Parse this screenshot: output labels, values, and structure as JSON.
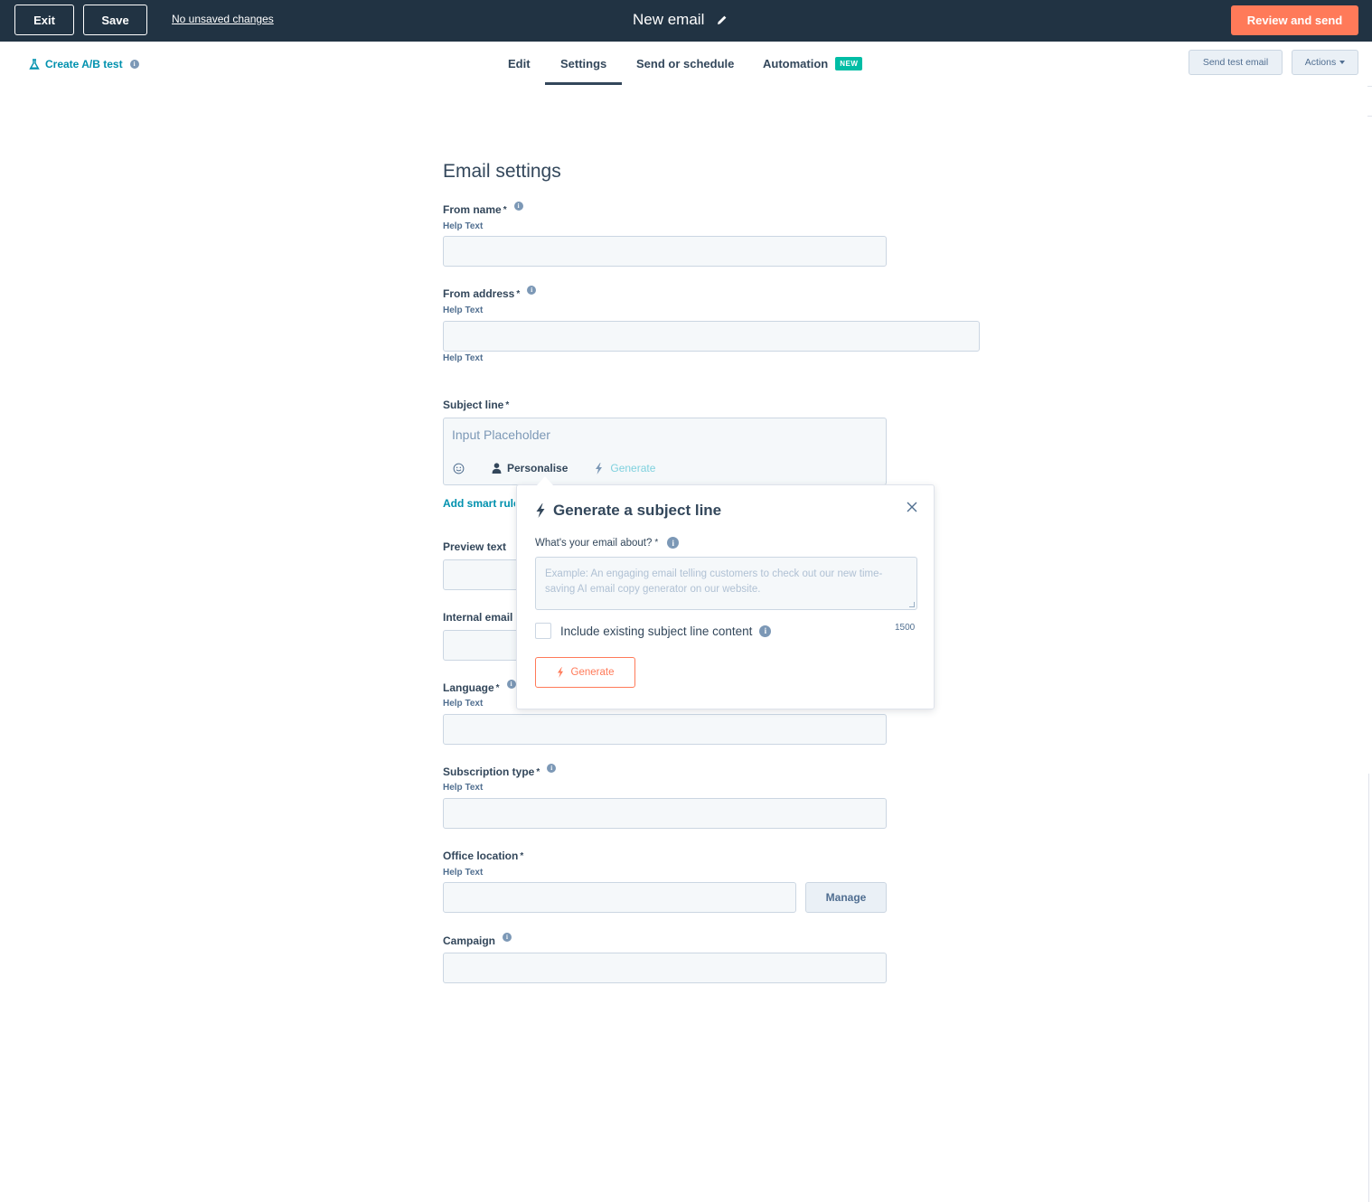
{
  "topbar": {
    "exit_label": "Exit",
    "save_label": "Save",
    "unsaved_label": "No unsaved changes",
    "title": "New email",
    "review_label": "Review and send",
    "accent": "#ff7a59",
    "background": "#213343"
  },
  "subnav": {
    "ab_test_label": "Create A/B test",
    "tabs": [
      {
        "label": "Edit"
      },
      {
        "label": "Settings",
        "active": true
      },
      {
        "label": "Send or schedule"
      },
      {
        "label": "Automation",
        "badge": "NEW"
      }
    ],
    "send_test_label": "Send test email",
    "actions_label": "Actions"
  },
  "form": {
    "title": "Email settings",
    "fields": {
      "from_name": {
        "label": "From name",
        "required": "*",
        "help": "Help Text"
      },
      "from_address": {
        "label": "From address",
        "required": "*",
        "help": "Help Text",
        "help_below": "Help Text"
      },
      "subject_line": {
        "label": "Subject line",
        "required": "*",
        "placeholder": "Input Placeholder",
        "personalise_label": "Personalise",
        "generate_label": "Generate"
      },
      "smart_rules_label": "Add smart rules",
      "preview_text": {
        "label": "Preview text"
      },
      "internal_email": {
        "label": "Internal email name"
      },
      "language": {
        "label": "Language",
        "required": "*",
        "help": "Help Text"
      },
      "subscription_type": {
        "label": "Subscription type",
        "required": "*",
        "help": "Help Text"
      },
      "office_location": {
        "label": "Office location",
        "required": "*",
        "help": "Help Text",
        "manage_label": "Manage"
      },
      "campaign": {
        "label": "Campaign"
      }
    }
  },
  "popover": {
    "title": "Generate a subject line",
    "question_label": "What's your email about?",
    "required": "*",
    "textarea_placeholder": "Example: An engaging email telling customers to check out our new time-saving AI email copy generator on our website.",
    "include_label": "Include existing subject line content",
    "char_count": "1500",
    "generate_label": "Generate"
  },
  "icons": {
    "pencil": "pencil-icon",
    "flask": "flask-icon",
    "info": "info-icon",
    "emoji": "emoji-icon",
    "person": "person-icon",
    "lightning": "lightning-icon",
    "close": "close-icon"
  }
}
